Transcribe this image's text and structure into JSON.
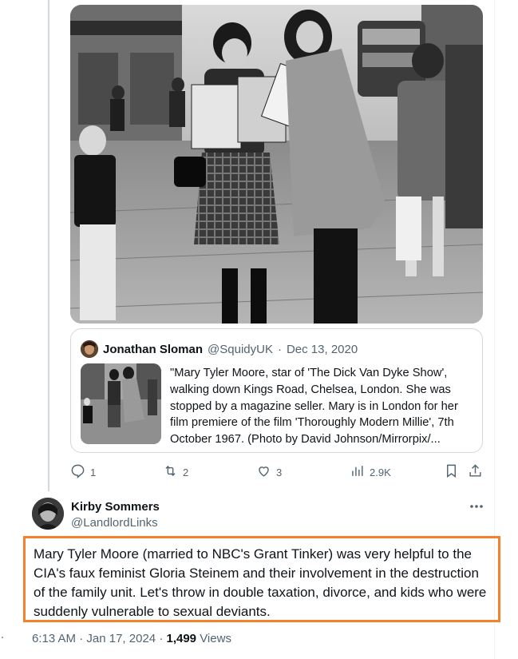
{
  "quoted_tweet": {
    "author_name": "Jonathan Sloman",
    "author_handle": "@SquidyUK",
    "date": "Dec 13, 2020",
    "text": "\"Mary Tyler Moore, star of 'The Dick Van Dyke Show', walking down Kings Road, Chelsea, London. She was stopped by a magazine seller. Mary is in London for her film premiere of the film 'Thoroughly Modern Millie', 7th October 1967. (Photo by David Johnson/Mirrorpix/..."
  },
  "actions": {
    "replies": "1",
    "reposts": "2",
    "likes": "3",
    "views": "2.9K"
  },
  "reply": {
    "author_name": "Kirby Sommers",
    "author_handle": "@LandlordLinks",
    "text": "Mary Tyler Moore (married to NBC's Grant Tinker) was very helpful to the CIA's faux feminist Gloria Steinem and their involvement in the destruction of the family unit. Let's throw in double taxation, divorce, and kids who were suddenly vulnerable to sexual deviants.",
    "time": "6:13 AM",
    "date": "Jan 17, 2024",
    "views_count": "1,499",
    "views_label": "Views"
  },
  "icons": [
    "reply-icon",
    "repost-icon",
    "like-icon",
    "views-icon",
    "bookmark-icon",
    "share-icon",
    "more-icon"
  ],
  "colors": {
    "highlight_border": "#f4822c",
    "muted_text": "#536471",
    "border": "#cfd9de"
  }
}
